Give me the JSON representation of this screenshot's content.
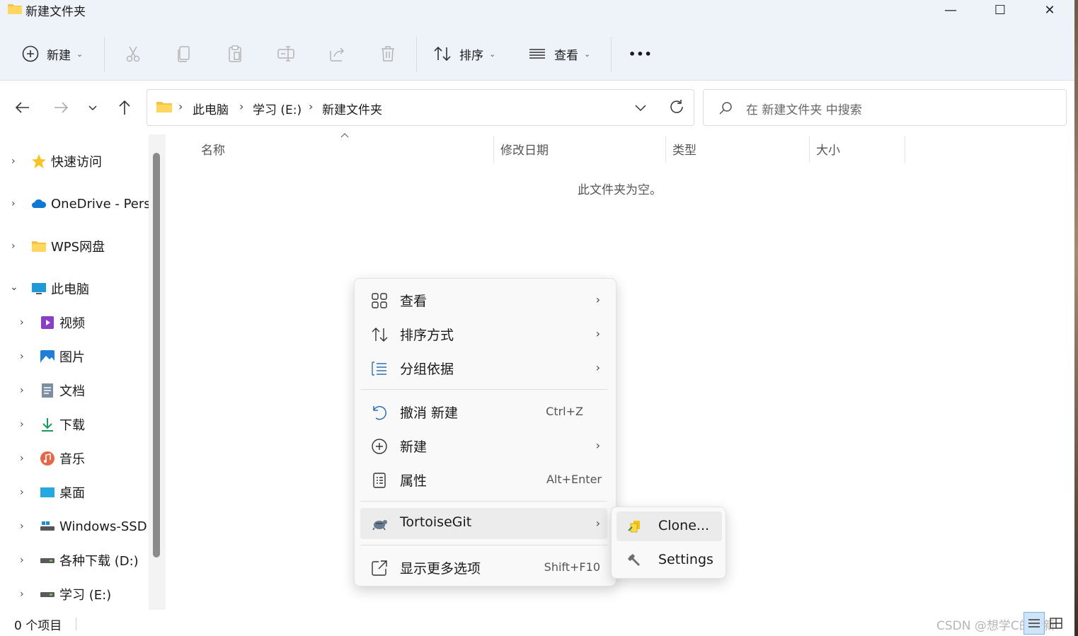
{
  "window": {
    "title": "新建文件夹",
    "controls": {
      "minimize": "—",
      "maximize": "☐",
      "close": "✕"
    }
  },
  "toolbar": {
    "new_label": "新建",
    "sort_label": "排序",
    "view_label": "查看",
    "more_label": "•••",
    "disabled_actions": [
      "scissors-icon",
      "copy-icon",
      "paste-icon",
      "rename-icon",
      "share-icon",
      "delete-icon"
    ]
  },
  "address": {
    "crumbs": [
      "此电脑",
      "学习 (E:)",
      "新建文件夹"
    ],
    "separator": "›"
  },
  "search": {
    "placeholder": "在 新建文件夹 中搜索"
  },
  "sidebar": {
    "items": [
      {
        "label": "快速访问",
        "icon": "star-icon",
        "expanded": false
      },
      {
        "label": "OneDrive - Pers",
        "icon": "onedrive-cloud-icon",
        "expanded": false
      },
      {
        "label": "WPS网盘",
        "icon": "folder-icon",
        "expanded": false
      },
      {
        "label": "此电脑",
        "icon": "computer-icon",
        "expanded": true
      },
      {
        "label": "视频",
        "icon": "video-icon",
        "expanded": false
      },
      {
        "label": "图片",
        "icon": "pictures-icon",
        "expanded": false
      },
      {
        "label": "文档",
        "icon": "documents-icon",
        "expanded": false
      },
      {
        "label": "下载",
        "icon": "download-icon",
        "expanded": false
      },
      {
        "label": "音乐",
        "icon": "music-icon",
        "expanded": false
      },
      {
        "label": "桌面",
        "icon": "desktop-icon",
        "expanded": false
      },
      {
        "label": "Windows-SSD",
        "icon": "drive-icon",
        "expanded": false
      },
      {
        "label": "各种下载 (D:)",
        "icon": "drive-icon",
        "expanded": false
      },
      {
        "label": "学习 (E:)",
        "icon": "drive-icon",
        "expanded": false,
        "selected": true
      }
    ]
  },
  "columns": [
    "名称",
    "修改日期",
    "类型",
    "大小"
  ],
  "content": {
    "empty_message": "此文件夹为空。"
  },
  "status": {
    "count": "0 个项目",
    "watermark": "CSDN @想学C的萌新"
  },
  "context_menu": {
    "items": [
      {
        "label": "查看",
        "icon": "view-grid-icon",
        "shortcut": "",
        "submenu": true
      },
      {
        "label": "排序方式",
        "icon": "sort-icon",
        "shortcut": "",
        "submenu": true
      },
      {
        "label": "分组依据",
        "icon": "group-list-icon",
        "shortcut": "",
        "submenu": true
      },
      {
        "label": "撤消 新建",
        "icon": "undo-icon",
        "shortcut": "Ctrl+Z",
        "submenu": false
      },
      {
        "label": "新建",
        "icon": "plus-circle-icon",
        "shortcut": "",
        "submenu": true
      },
      {
        "label": "属性",
        "icon": "properties-icon",
        "shortcut": "Alt+Enter",
        "submenu": false
      },
      {
        "label": "TortoiseGit",
        "icon": "tortoisegit-icon",
        "shortcut": "",
        "submenu": true
      },
      {
        "label": "显示更多选项",
        "icon": "more-options-icon",
        "shortcut": "Shift+F10",
        "submenu": false
      }
    ],
    "arrow": "›"
  },
  "tortoise_submenu": {
    "items": [
      {
        "label": "Clone...",
        "icon": "clone-icon"
      },
      {
        "label": "Settings",
        "icon": "wrench-icon"
      }
    ]
  },
  "colors": {
    "accent": "#0067c0",
    "folder": "#f5c242",
    "titlebar_bg": "#eef3f9"
  }
}
